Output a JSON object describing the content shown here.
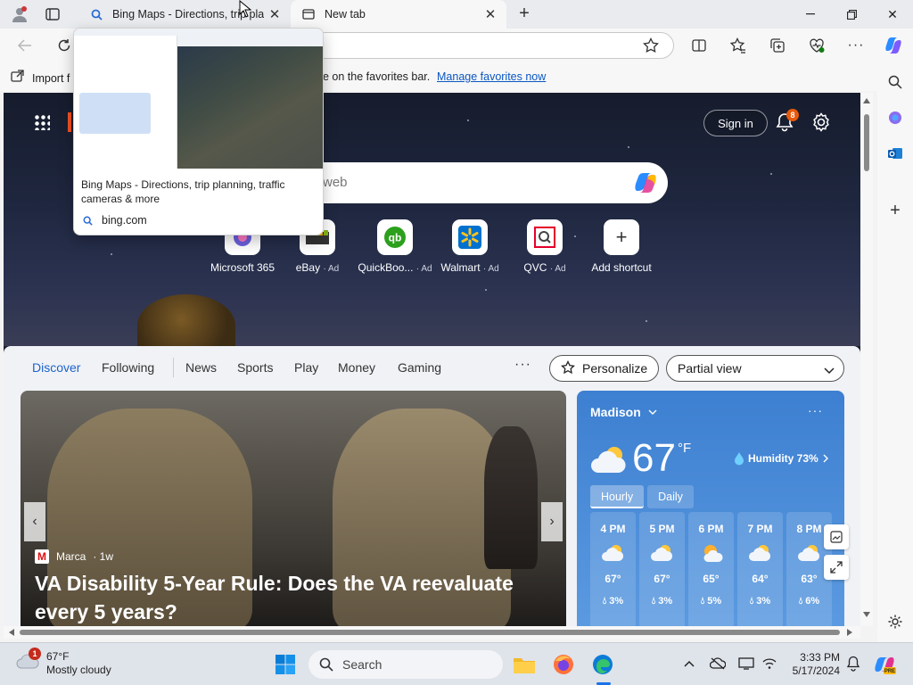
{
  "browser": {
    "tabs": [
      {
        "label": "Bing Maps - Directions, trip plann",
        "state": "hovered"
      },
      {
        "label": "New tab",
        "state": "active"
      }
    ],
    "favorites_bar": {
      "import_label": "Import f",
      "message": "e on the favorites bar.",
      "manage_link": "Manage favorites now"
    }
  },
  "tab_preview": {
    "title": "Bing Maps - Directions, trip planning, traffic cameras & more",
    "url": "bing.com"
  },
  "new_tab_page": {
    "sign_in_label": "Sign in",
    "notification_count": "8",
    "search_placeholder": "web",
    "shortcuts": [
      {
        "label": "Microsoft 365",
        "ad": ""
      },
      {
        "label": "eBay",
        "ad": "· Ad"
      },
      {
        "label": "QuickBoo...",
        "ad": "· Ad"
      },
      {
        "label": "Walmart",
        "ad": "· Ad"
      },
      {
        "label": "QVC",
        "ad": "· Ad"
      },
      {
        "label": "Add shortcut",
        "ad": ""
      }
    ],
    "feed_nav": {
      "items": [
        "Discover",
        "Following",
        "News",
        "Sports",
        "Play",
        "Money",
        "Gaming"
      ],
      "active": "Discover",
      "more": "···",
      "personalize": "Personalize",
      "view_select": "Partial view"
    },
    "top_story": {
      "source": "Marca",
      "age": "· 1w",
      "headline": "VA Disability 5-Year Rule: Does the VA reevaluate every 5 years?"
    },
    "weather": {
      "location": "Madison",
      "temperature": "67",
      "unit": "°F",
      "humidity": "Humidity 73%",
      "tabs": [
        "Hourly",
        "Daily"
      ],
      "selected_tab": "Hourly",
      "hours": [
        {
          "time": "4 PM",
          "temp": "67°",
          "precip": "3%",
          "icon": "partly-cloudy-icon"
        },
        {
          "time": "5 PM",
          "temp": "67°",
          "precip": "3%",
          "icon": "partly-cloudy-icon"
        },
        {
          "time": "6 PM",
          "temp": "65°",
          "precip": "5%",
          "icon": "partly-sunny-icon"
        },
        {
          "time": "7 PM",
          "temp": "64°",
          "precip": "3%",
          "icon": "partly-cloudy-icon"
        },
        {
          "time": "8 PM",
          "temp": "63°",
          "precip": "6%",
          "icon": "partly-cloudy-icon"
        }
      ]
    }
  },
  "taskbar": {
    "weather_temp": "67°F",
    "weather_desc": "Mostly cloudy",
    "weather_badge": "1",
    "search_label": "Search",
    "time": "3:33 PM",
    "date": "5/17/2024"
  },
  "colors": {
    "accent": "#1e63cc",
    "link": "#0b57c2",
    "weather_bg": "#4a8ad8",
    "notification_badge": "#e8590c"
  }
}
